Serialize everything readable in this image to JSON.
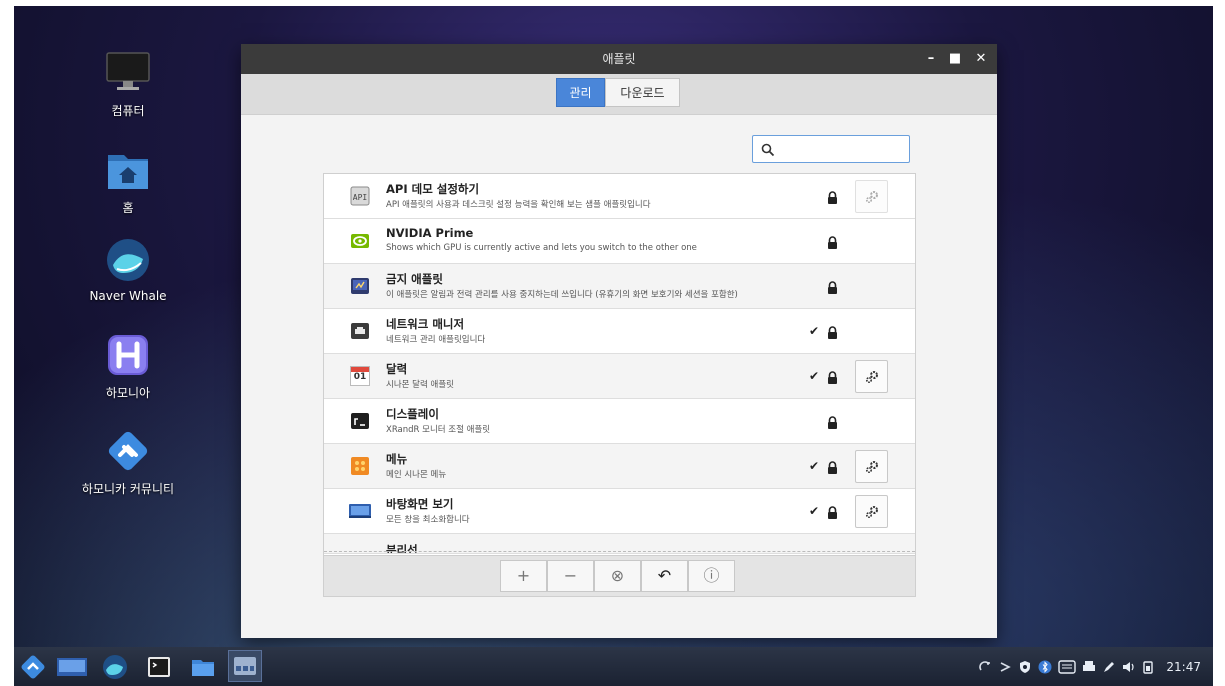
{
  "desktop": {
    "icons": [
      {
        "label": "컴퓨터",
        "icon": "monitor-icon"
      },
      {
        "label": "홈",
        "icon": "home-folder-icon"
      },
      {
        "label": "Naver Whale",
        "icon": "whale-browser-icon"
      },
      {
        "label": "하모니아",
        "icon": "hamonia-icon"
      },
      {
        "label": "하모니카 커뮤니티",
        "icon": "hamonikr-community-icon"
      }
    ]
  },
  "window": {
    "title": "애플릿",
    "controls": {
      "minimize": "–",
      "maximize": "■",
      "close": "✕"
    },
    "tabs": [
      {
        "label": "관리",
        "active": true
      },
      {
        "label": "다운로드",
        "active": false
      }
    ],
    "search": {
      "value": "",
      "placeholder": ""
    },
    "applets": [
      {
        "title": "API 데모 설정하기",
        "desc": "API 애플릿의 사용과 데스크릿 설정 능력을 확인해 보는 샘플 애플릿입니다",
        "icon": "api-demo-icon",
        "checked": false,
        "locked": true,
        "configurable": true,
        "config_enabled": false
      },
      {
        "title": "NVIDIA Prime",
        "desc": "Shows which GPU is currently active and lets you switch to the other one",
        "icon": "nvidia-icon",
        "checked": false,
        "locked": true,
        "configurable": false
      },
      {
        "title": "금지 애플릿",
        "desc": "이 애플릿은 알림과 전력 관리를 사용 중지하는데 쓰입니다 (유휴기의 화면 보호기와 세션을 포함한)",
        "icon": "inhibit-icon",
        "checked": false,
        "locked": true,
        "configurable": false
      },
      {
        "title": "네트워크 매니저",
        "desc": "네트워크 관리 애플릿입니다",
        "icon": "network-icon",
        "checked": true,
        "locked": true,
        "configurable": false
      },
      {
        "title": "달력",
        "desc": "시나몬 달력 애플릿",
        "icon": "calendar-icon",
        "icon_text": "01",
        "checked": true,
        "locked": true,
        "configurable": true,
        "config_enabled": true
      },
      {
        "title": "디스플레이",
        "desc": "XRandR 모니터 조절 애플릿",
        "icon": "display-icon",
        "checked": false,
        "locked": true,
        "configurable": false
      },
      {
        "title": "메뉴",
        "desc": "메인 시나몬 메뉴",
        "icon": "menu-icon",
        "checked": true,
        "locked": true,
        "configurable": true,
        "config_enabled": true
      },
      {
        "title": "바탕화면 보기",
        "desc": "모든 창을 최소화합니다",
        "icon": "show-desktop-icon",
        "checked": true,
        "locked": true,
        "configurable": true,
        "config_enabled": true
      },
      {
        "title": "분리선",
        "desc": "",
        "icon": "separator-icon",
        "checked": false,
        "locked": true,
        "configurable": false
      }
    ],
    "toolbar": [
      {
        "label": "+",
        "name": "add-applet-button"
      },
      {
        "label": "−",
        "name": "remove-applet-button"
      },
      {
        "label": "⊗",
        "name": "uninstall-applet-button"
      },
      {
        "label": "↶",
        "name": "restore-defaults-button"
      },
      {
        "label": "ⓘ",
        "name": "more-info-button"
      }
    ]
  },
  "taskbar": {
    "launchers": [
      "hamonikr-menu-icon",
      "show-desktop-icon",
      "whale-browser-icon",
      "terminal-icon",
      "file-manager-icon",
      "applets-window-icon"
    ],
    "tray": [
      "sync-icon",
      "rapidcheck-icon",
      "shield-icon",
      "bluetooth-icon",
      "keyboard-icon",
      "printer-icon",
      "edit-icon",
      "volume-icon",
      "battery-icon"
    ],
    "clock": "21:47"
  },
  "colors": {
    "accent": "#4a86d9",
    "titlebar": "#3b3b3b",
    "taskbar": "#1f2636"
  }
}
